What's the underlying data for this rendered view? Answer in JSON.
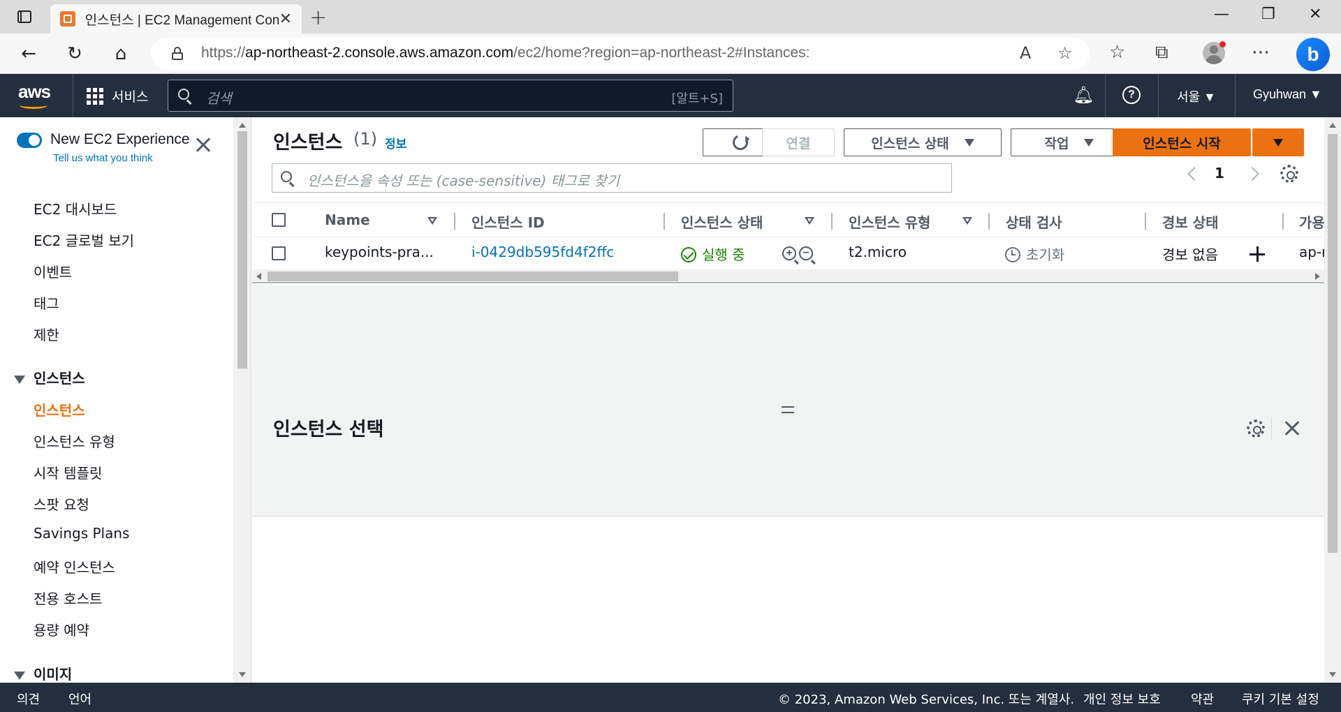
{
  "browser": {
    "tab_title": "인스턴스 | EC2 Management Con",
    "url_prefix": "https://",
    "url_host": "ap-northeast-2.console.aws.amazon.com",
    "url_path": "/ec2/home?region=ap-northeast-2#Instances:"
  },
  "aws_nav": {
    "logo": "aws",
    "services_label": "서비스",
    "search_placeholder": "검색",
    "search_shortcut": "[알트+S]",
    "region": "서울 ▼",
    "user": "Gyuhwan ▼"
  },
  "sidebar": {
    "experience_title": "New EC2 Experience",
    "experience_link": "Tell us what you think",
    "items_top": [
      "EC2 대시보드",
      "EC2 글로벌 보기",
      "이벤트",
      "태그",
      "제한"
    ],
    "section_instances": "인스턴스",
    "items_instances": [
      "인스턴스",
      "인스턴스 유형",
      "시작 템플릿",
      "스팟 요청",
      "Savings Plans",
      "예약 인스턴스",
      "전용 호스트",
      "용량 예약"
    ],
    "section_images": "이미지"
  },
  "main": {
    "title": "인스턴스",
    "count": "(1)",
    "info": "정보",
    "btn_connect": "연결",
    "btn_state": "인스턴스 상태",
    "btn_actions": "작업",
    "btn_launch": "인스턴스 시작",
    "filter_placeholder": "인스턴스을 속성 또는 (case-sensitive) 태그로 찾기",
    "page": "1",
    "columns": [
      "Name",
      "인스턴스 ID",
      "인스턴스 상태",
      "인스턴스 유형",
      "상태 검사",
      "경보 상태",
      "가용"
    ],
    "row": {
      "name": "keypoints-pra...",
      "instance_id": "i-0429db595fd4f2ffc",
      "state": "실행 중",
      "type": "t2.micro",
      "status_check": "초기화",
      "alarm": "경보 없음",
      "az": "ap-n"
    },
    "panel_title": "인스턴스 선택"
  },
  "footer": {
    "feedback": "의견",
    "language": "언어",
    "copyright": "© 2023, Amazon Web Services, Inc. 또는 계열사.",
    "privacy": "개인 정보 보호",
    "terms": "약관",
    "cookies": "쿠키 기본 설정"
  }
}
